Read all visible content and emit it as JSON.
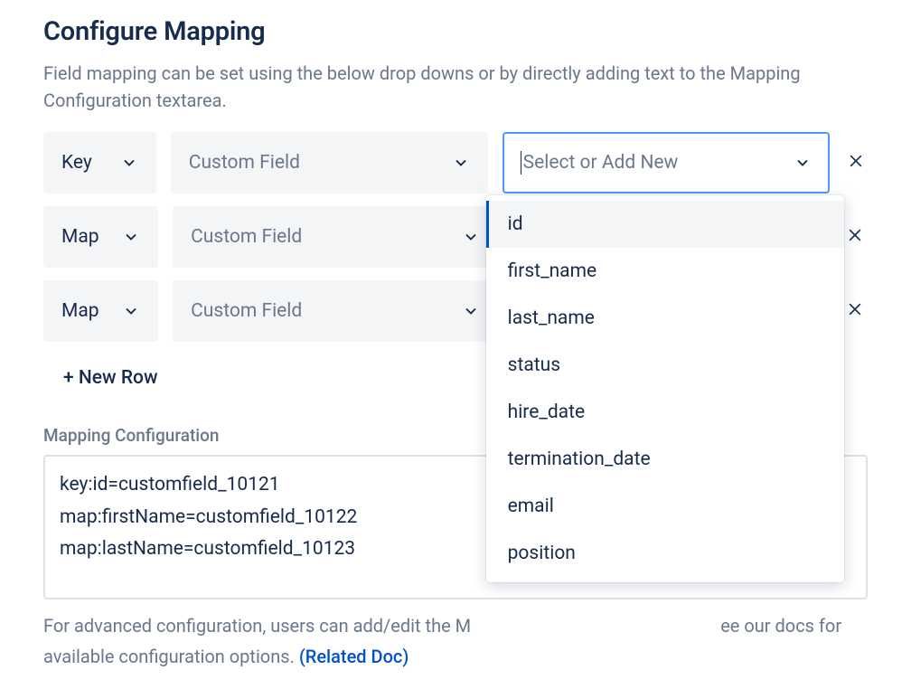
{
  "title": "Configure Mapping",
  "description": "Field mapping can be set using the below drop downs or by directly adding text to the Mapping Configuration textarea.",
  "rows": {
    "r0": {
      "type": "Key",
      "field": "Custom Field",
      "new_text": "Select or Add New"
    },
    "r1": {
      "type": "Map",
      "field": "Custom Field"
    },
    "r2": {
      "type": "Map",
      "field": "Custom Field"
    }
  },
  "new_row_label": "+ New Row",
  "config_label": "Mapping Configuration",
  "config_text": "key:id=customfield_10121\nmap:firstName=customfield_10122\nmap:lastName=customfield_10123",
  "footer_prefix": "For advanced configuration, users can add/edit the M",
  "footer_suffix": "ee our docs for available configuration options.   ",
  "footer_link": "(Related Doc)",
  "dropdown_options": {
    "o0": "id",
    "o1": "first_name",
    "o2": "last_name",
    "o3": "status",
    "o4": "hire_date",
    "o5": "termination_date",
    "o6": "email",
    "o7": "position"
  }
}
